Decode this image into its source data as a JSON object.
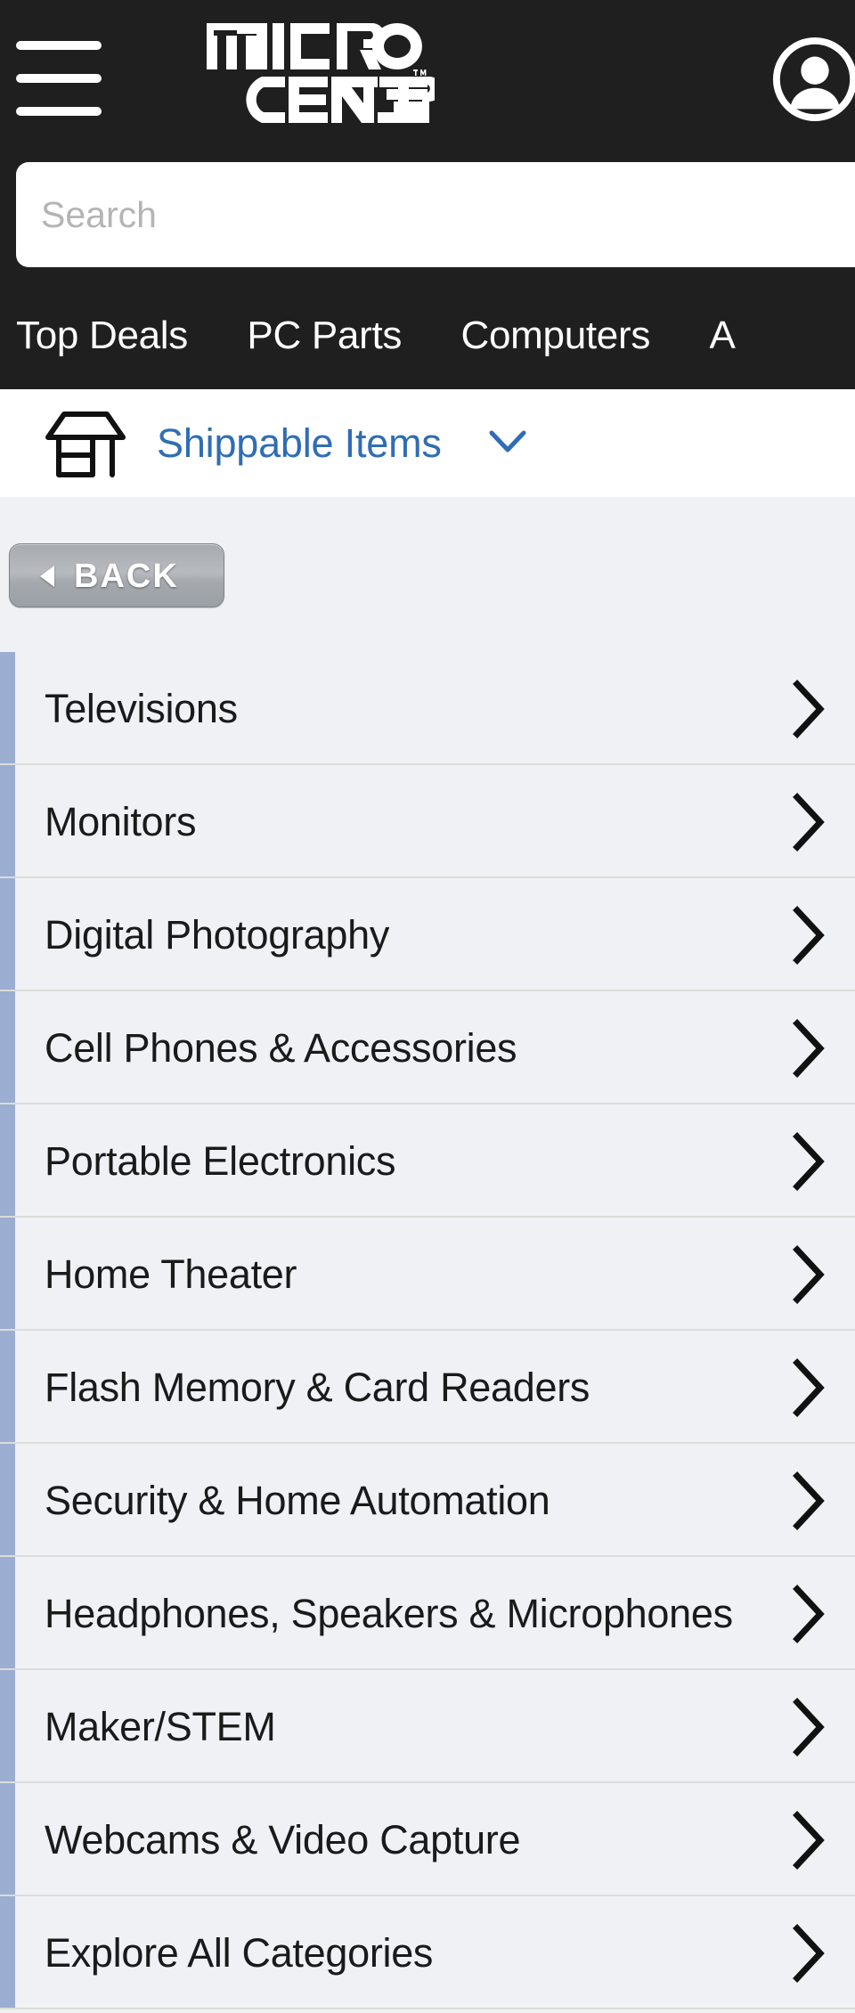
{
  "header": {
    "background_color": "#1f1f1f",
    "menu_icon": "hamburger-icon",
    "logo_text": "MICRO CENTER",
    "logo_trademark": "TM",
    "account_icon": "account-circle-icon",
    "search": {
      "placeholder": "Search",
      "value": ""
    },
    "nav_items": [
      {
        "label": "Top Deals"
      },
      {
        "label": "PC Parts"
      },
      {
        "label": "Computers"
      },
      {
        "label": "A"
      }
    ]
  },
  "shipping_bar": {
    "store_icon": "storefront-icon",
    "label": "Shippable Items",
    "caret_icon": "chevron-down-icon",
    "link_color": "#2f6db5"
  },
  "content": {
    "back_button": {
      "label": "BACK",
      "arrow_icon": "triangle-left-icon"
    },
    "accent_color": "#9badd0",
    "background_color": "#f0f1f5",
    "categories": [
      {
        "label": "Televisions",
        "chevron": "chevron-right-icon"
      },
      {
        "label": "Monitors",
        "chevron": "chevron-right-icon"
      },
      {
        "label": "Digital Photography",
        "chevron": "chevron-right-icon"
      },
      {
        "label": "Cell Phones & Accessories",
        "chevron": "chevron-right-icon"
      },
      {
        "label": "Portable Electronics",
        "chevron": "chevron-right-icon"
      },
      {
        "label": "Home Theater",
        "chevron": "chevron-right-icon"
      },
      {
        "label": "Flash Memory & Card Readers",
        "chevron": "chevron-right-icon"
      },
      {
        "label": "Security & Home Automation",
        "chevron": "chevron-right-icon"
      },
      {
        "label": "Headphones, Speakers & Microphones",
        "chevron": "chevron-right-icon"
      },
      {
        "label": "Maker/STEM",
        "chevron": "chevron-right-icon"
      },
      {
        "label": "Webcams & Video Capture",
        "chevron": "chevron-right-icon"
      },
      {
        "label": "Explore All Categories",
        "chevron": "chevron-right-icon"
      }
    ]
  }
}
